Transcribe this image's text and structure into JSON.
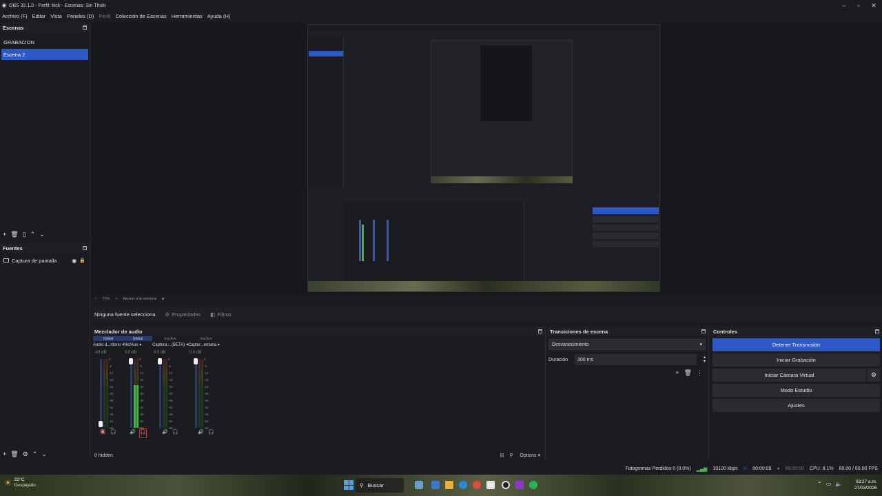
{
  "window": {
    "title": "OBS 32.1.0 - Perfil: kick - Escenas: Sin Título",
    "controls": [
      "–",
      "▫",
      "✕"
    ]
  },
  "menu": [
    "Archivo (F)",
    "Editar",
    "Vista",
    "Paneles (D)",
    "Perfil",
    "Colección de Escenas",
    "Herramientas",
    "Ayuda (H)"
  ],
  "scenes": {
    "title": "Escenas",
    "items": [
      "GRABACION",
      "Escena 2"
    ],
    "active_index": 1
  },
  "sources": {
    "title": "Fuentes",
    "items": [
      "Captura de pantalla"
    ]
  },
  "zoom": {
    "minus": "–",
    "level": "71%",
    "plus": "+",
    "fit_label": "Ajustar a la ventana"
  },
  "context": {
    "no_source": "Ninguna fuente selecciona",
    "properties": "Propiedades",
    "filters": "Filtros"
  },
  "mixer": {
    "title": "Mezclador de audio",
    "channels": [
      {
        "badge": "Global",
        "name": "Audio d...ritorio",
        "db": "-inf dB",
        "level": 0.0,
        "muted": true
      },
      {
        "badge": "Global",
        "name": "Mic/Aux",
        "db": "0.0 dB",
        "level": 0.62,
        "muted": true
      },
      {
        "badge": "Inactive",
        "name": "Captura... (BETA)",
        "db": "0.0 dB",
        "level": 0.0,
        "muted": false
      },
      {
        "badge": "Inactive",
        "name": "Captur...entana",
        "db": "0.0 dB",
        "level": 0.0,
        "muted": false
      }
    ],
    "scale": [
      "0",
      "-6",
      "-12",
      "-18",
      "-24",
      "-30",
      "-36",
      "-42",
      "-48",
      "-54",
      "-60"
    ],
    "hidden_label": "0 hidden",
    "options_label": "Options"
  },
  "transitions": {
    "title": "Transiciones de escena",
    "selected": "Desvanecimiento",
    "duration_label": "Duración",
    "duration_value": "300 ms"
  },
  "controls": {
    "title": "Controles",
    "buttons": [
      "Detener Transmisión",
      "Iniciar Grabación",
      "Iniciar Cámara Virtual",
      "Modo Estudio",
      "Ajustes"
    ]
  },
  "status": {
    "dropped": "Fotogramas Perdidos 0 (0.0%)",
    "bitrate": "10100 kbps",
    "stream_time": "00:00:09",
    "rec_time": "00:00:00",
    "cpu": "CPU: 8.1%",
    "fps": "60.00 / 60.00 FPS"
  },
  "taskbar": {
    "weather_temp": "22°C",
    "weather_desc": "Despejado",
    "search": "Buscar",
    "time": "03:27 a.m.",
    "date": "27/03/2026"
  },
  "colors": {
    "accent": "#2d59c8",
    "panel": "#1b1c20",
    "meter_green": "#4caf50",
    "meter_yellow": "#c9b628",
    "meter_red": "#c0392b"
  }
}
